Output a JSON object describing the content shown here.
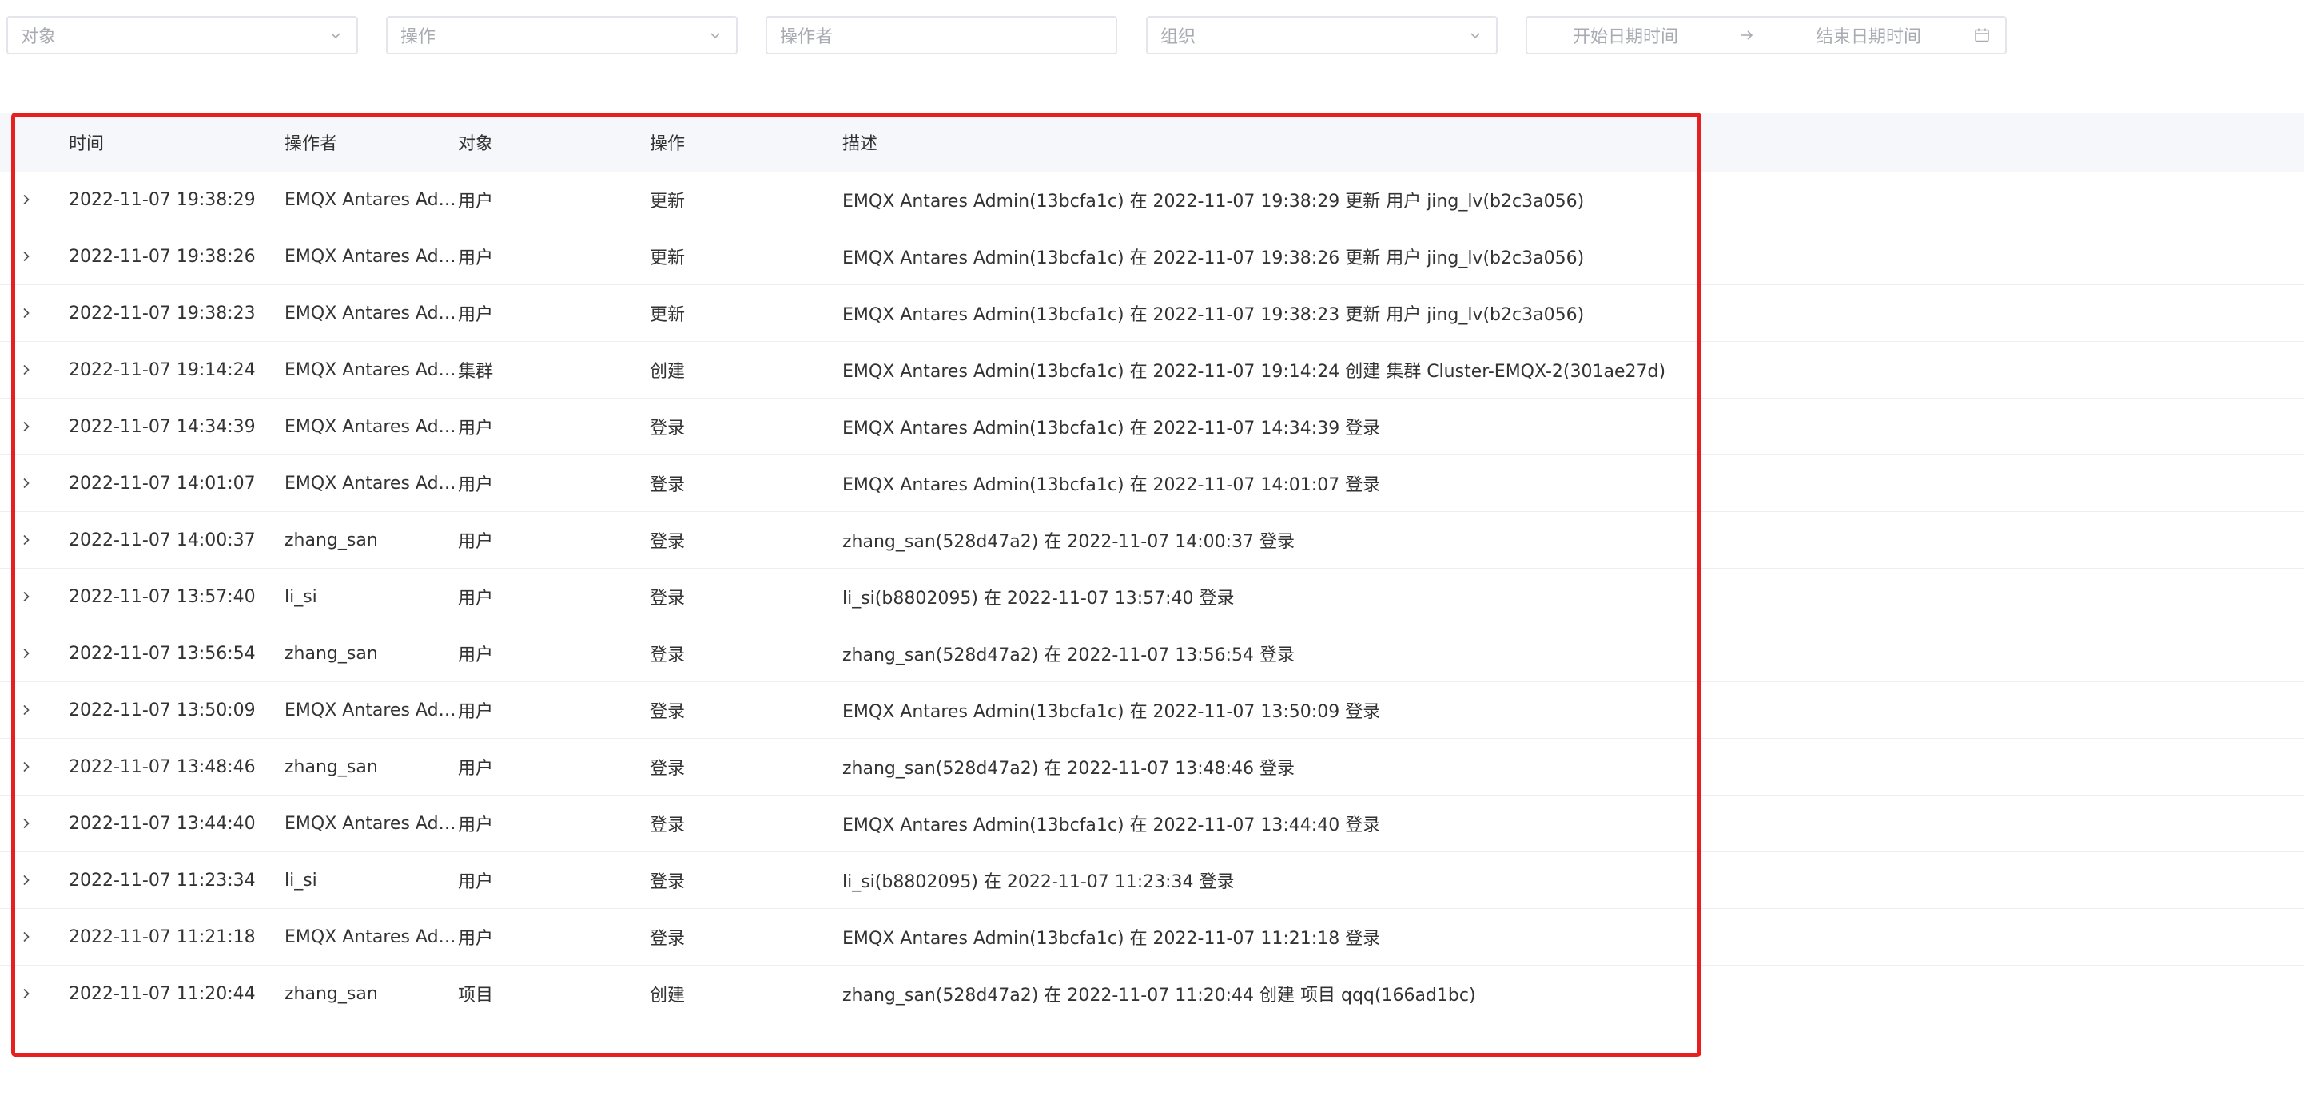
{
  "filters": {
    "object_placeholder": "对象",
    "action_placeholder": "操作",
    "operator_placeholder": "操作者",
    "org_placeholder": "组织",
    "start_placeholder": "开始日期时间",
    "end_placeholder": "结束日期时间"
  },
  "table": {
    "headers": {
      "time": "时间",
      "operator": "操作者",
      "object": "对象",
      "action": "操作",
      "description": "描述"
    },
    "rows": [
      {
        "time": "2022-11-07 19:38:29",
        "operator": "EMQX Antares Admin",
        "object": "用户",
        "action": "更新",
        "description": "EMQX Antares Admin(13bcfa1c) 在 2022-11-07 19:38:29 更新 用户 jing_lv(b2c3a056)"
      },
      {
        "time": "2022-11-07 19:38:26",
        "operator": "EMQX Antares Admin",
        "object": "用户",
        "action": "更新",
        "description": "EMQX Antares Admin(13bcfa1c) 在 2022-11-07 19:38:26 更新 用户 jing_lv(b2c3a056)"
      },
      {
        "time": "2022-11-07 19:38:23",
        "operator": "EMQX Antares Admin",
        "object": "用户",
        "action": "更新",
        "description": "EMQX Antares Admin(13bcfa1c) 在 2022-11-07 19:38:23 更新 用户 jing_lv(b2c3a056)"
      },
      {
        "time": "2022-11-07 19:14:24",
        "operator": "EMQX Antares Admin",
        "object": "集群",
        "action": "创建",
        "description": "EMQX Antares Admin(13bcfa1c) 在 2022-11-07 19:14:24 创建 集群 Cluster-EMQX-2(301ae27d)"
      },
      {
        "time": "2022-11-07 14:34:39",
        "operator": "EMQX Antares Admin",
        "object": "用户",
        "action": "登录",
        "description": "EMQX Antares Admin(13bcfa1c) 在 2022-11-07 14:34:39 登录"
      },
      {
        "time": "2022-11-07 14:01:07",
        "operator": "EMQX Antares Admin",
        "object": "用户",
        "action": "登录",
        "description": "EMQX Antares Admin(13bcfa1c) 在 2022-11-07 14:01:07 登录"
      },
      {
        "time": "2022-11-07 14:00:37",
        "operator": "zhang_san",
        "object": "用户",
        "action": "登录",
        "description": "zhang_san(528d47a2) 在 2022-11-07 14:00:37 登录"
      },
      {
        "time": "2022-11-07 13:57:40",
        "operator": "li_si",
        "object": "用户",
        "action": "登录",
        "description": "li_si(b8802095) 在 2022-11-07 13:57:40 登录"
      },
      {
        "time": "2022-11-07 13:56:54",
        "operator": "zhang_san",
        "object": "用户",
        "action": "登录",
        "description": "zhang_san(528d47a2) 在 2022-11-07 13:56:54 登录"
      },
      {
        "time": "2022-11-07 13:50:09",
        "operator": "EMQX Antares Admin",
        "object": "用户",
        "action": "登录",
        "description": "EMQX Antares Admin(13bcfa1c) 在 2022-11-07 13:50:09 登录"
      },
      {
        "time": "2022-11-07 13:48:46",
        "operator": "zhang_san",
        "object": "用户",
        "action": "登录",
        "description": "zhang_san(528d47a2) 在 2022-11-07 13:48:46 登录"
      },
      {
        "time": "2022-11-07 13:44:40",
        "operator": "EMQX Antares Admin",
        "object": "用户",
        "action": "登录",
        "description": "EMQX Antares Admin(13bcfa1c) 在 2022-11-07 13:44:40 登录"
      },
      {
        "time": "2022-11-07 11:23:34",
        "operator": "li_si",
        "object": "用户",
        "action": "登录",
        "description": "li_si(b8802095) 在 2022-11-07 11:23:34 登录"
      },
      {
        "time": "2022-11-07 11:21:18",
        "operator": "EMQX Antares Admin",
        "object": "用户",
        "action": "登录",
        "description": "EMQX Antares Admin(13bcfa1c) 在 2022-11-07 11:21:18 登录"
      },
      {
        "time": "2022-11-07 11:20:44",
        "operator": "zhang_san",
        "object": "项目",
        "action": "创建",
        "description": "zhang_san(528d47a2) 在 2022-11-07 11:20:44 创建 项目 qqq(166ad1bc)"
      }
    ]
  },
  "icons": {
    "select_arrow": "chevron-down-icon",
    "range_separator": "arrow-right-icon",
    "date_picker": "calendar-icon",
    "row_expand": "chevron-right-icon"
  },
  "colors": {
    "highlight_border": "#e81f1f",
    "header_bg": "#f6f7fa",
    "placeholder_text": "#a8abb2"
  }
}
